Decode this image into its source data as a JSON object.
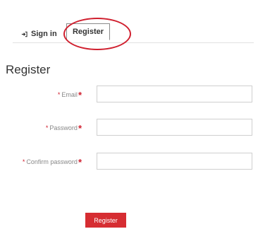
{
  "tabs": {
    "signin_label": "Sign in",
    "register_label": "Register"
  },
  "page": {
    "title": "Register"
  },
  "form": {
    "fields": [
      {
        "label": "Email",
        "value": ""
      },
      {
        "label": "Password",
        "value": ""
      },
      {
        "label": "Confirm password",
        "value": ""
      }
    ],
    "required_marker": "*",
    "submit_label": "Register"
  },
  "colors": {
    "accent": "#d62d32",
    "annotation": "#d01f2e"
  },
  "icons": {
    "signin": "sign-in-arrow-icon"
  }
}
